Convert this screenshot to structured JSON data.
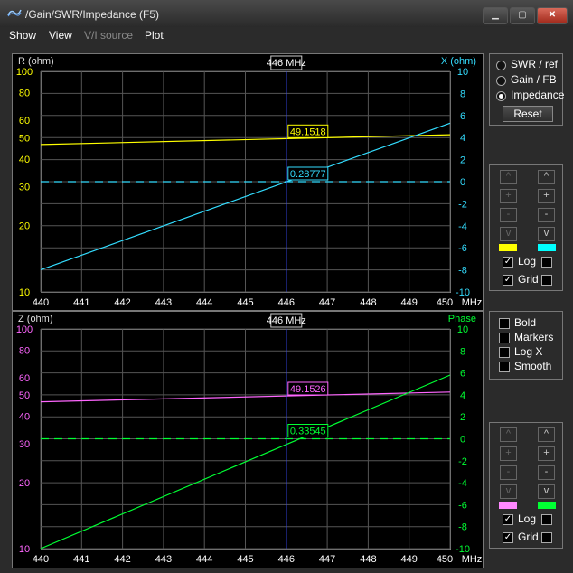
{
  "window": {
    "title": "/Gain/SWR/Impedance (F5)",
    "minimize": "▁",
    "maximize": "▢",
    "close": "✕"
  },
  "menu": {
    "show": "Show",
    "view": "View",
    "vi_source": "V/I source",
    "plot": "Plot"
  },
  "top_panel": {
    "mode_options": [
      "SWR / ref",
      "Gain / FB",
      "Impedance"
    ],
    "selected_mode": "Impedance",
    "reset": "Reset",
    "nav_buttons": [
      "^",
      "+",
      "-",
      "v"
    ],
    "left_color": "#ffff00",
    "right_color": "#00ffff",
    "log_label": "Log",
    "grid_label": "Grid",
    "log_left": true,
    "log_right": false,
    "grid_left": true,
    "grid_right": false
  },
  "middle_panel": {
    "bold": "Bold",
    "markers": "Markers",
    "logx": "Log X",
    "smooth": "Smooth"
  },
  "bottom_panel": {
    "nav_buttons": [
      "^",
      "+",
      "-",
      "v"
    ],
    "left_color": "#ff88ff",
    "right_color": "#00ff33",
    "log_label": "Log",
    "grid_label": "Grid",
    "log_left": true,
    "log_right": false,
    "grid_left": true,
    "grid_right": false
  },
  "chart_data": [
    {
      "type": "line",
      "x_unit_label": "MHz",
      "x_ticks": [
        "440",
        "441",
        "442",
        "443",
        "444",
        "445",
        "446",
        "447",
        "448",
        "449",
        "450"
      ],
      "x_range": [
        440,
        450
      ],
      "left_axis_label": "R (ohm)",
      "left_axis_scale": "log",
      "left_range": [
        10,
        100
      ],
      "left_ticks": [
        "10",
        "20",
        "30",
        "40",
        "50",
        "60",
        "80",
        "100"
      ],
      "right_axis_label": "X (ohm)",
      "right_range": [
        -10,
        10
      ],
      "right_ticks": [
        "-10",
        "-8",
        "-6",
        "-4",
        "-2",
        "0",
        "2",
        "4",
        "6",
        "8",
        "10"
      ],
      "cursor_label": "446 MHz",
      "cursor_x": 446,
      "left_readout": "49.1518",
      "right_readout": "0.28777",
      "series": [
        {
          "axis": "left",
          "color": "#ffff00",
          "x": [
            440,
            450
          ],
          "y": [
            46.6,
            51.6
          ]
        },
        {
          "axis": "right",
          "color": "#33ddff",
          "x": [
            440,
            450
          ],
          "y": [
            -8.0,
            5.3
          ]
        }
      ],
      "zero_line": {
        "axis": "right",
        "value": 0,
        "color": "#33ddff"
      }
    },
    {
      "type": "line",
      "x_unit_label": "MHz",
      "x_ticks": [
        "440",
        "441",
        "442",
        "443",
        "444",
        "445",
        "446",
        "447",
        "448",
        "449",
        "450"
      ],
      "x_range": [
        440,
        450
      ],
      "left_axis_label": "Z (ohm)",
      "left_axis_scale": "log",
      "left_range": [
        10,
        100
      ],
      "left_ticks": [
        "10",
        "20",
        "30",
        "40",
        "50",
        "60",
        "80",
        "100"
      ],
      "right_axis_label": "Phase",
      "right_range": [
        -10,
        10
      ],
      "right_ticks": [
        "-10",
        "-8",
        "-6",
        "-4",
        "-2",
        "0",
        "2",
        "4",
        "6",
        "8",
        "10"
      ],
      "cursor_label": "446 MHz",
      "cursor_x": 446,
      "left_readout": "49.1526",
      "right_readout": "0.33545",
      "series": [
        {
          "axis": "left",
          "color": "#ff88ff",
          "x": [
            440,
            450
          ],
          "y": [
            46.6,
            51.6
          ]
        },
        {
          "axis": "right",
          "color": "#00ff33",
          "x": [
            440,
            450
          ],
          "y": [
            -10,
            5.8
          ]
        }
      ],
      "zero_line": {
        "axis": "right",
        "value": 0,
        "color": "#00ff33"
      }
    }
  ]
}
